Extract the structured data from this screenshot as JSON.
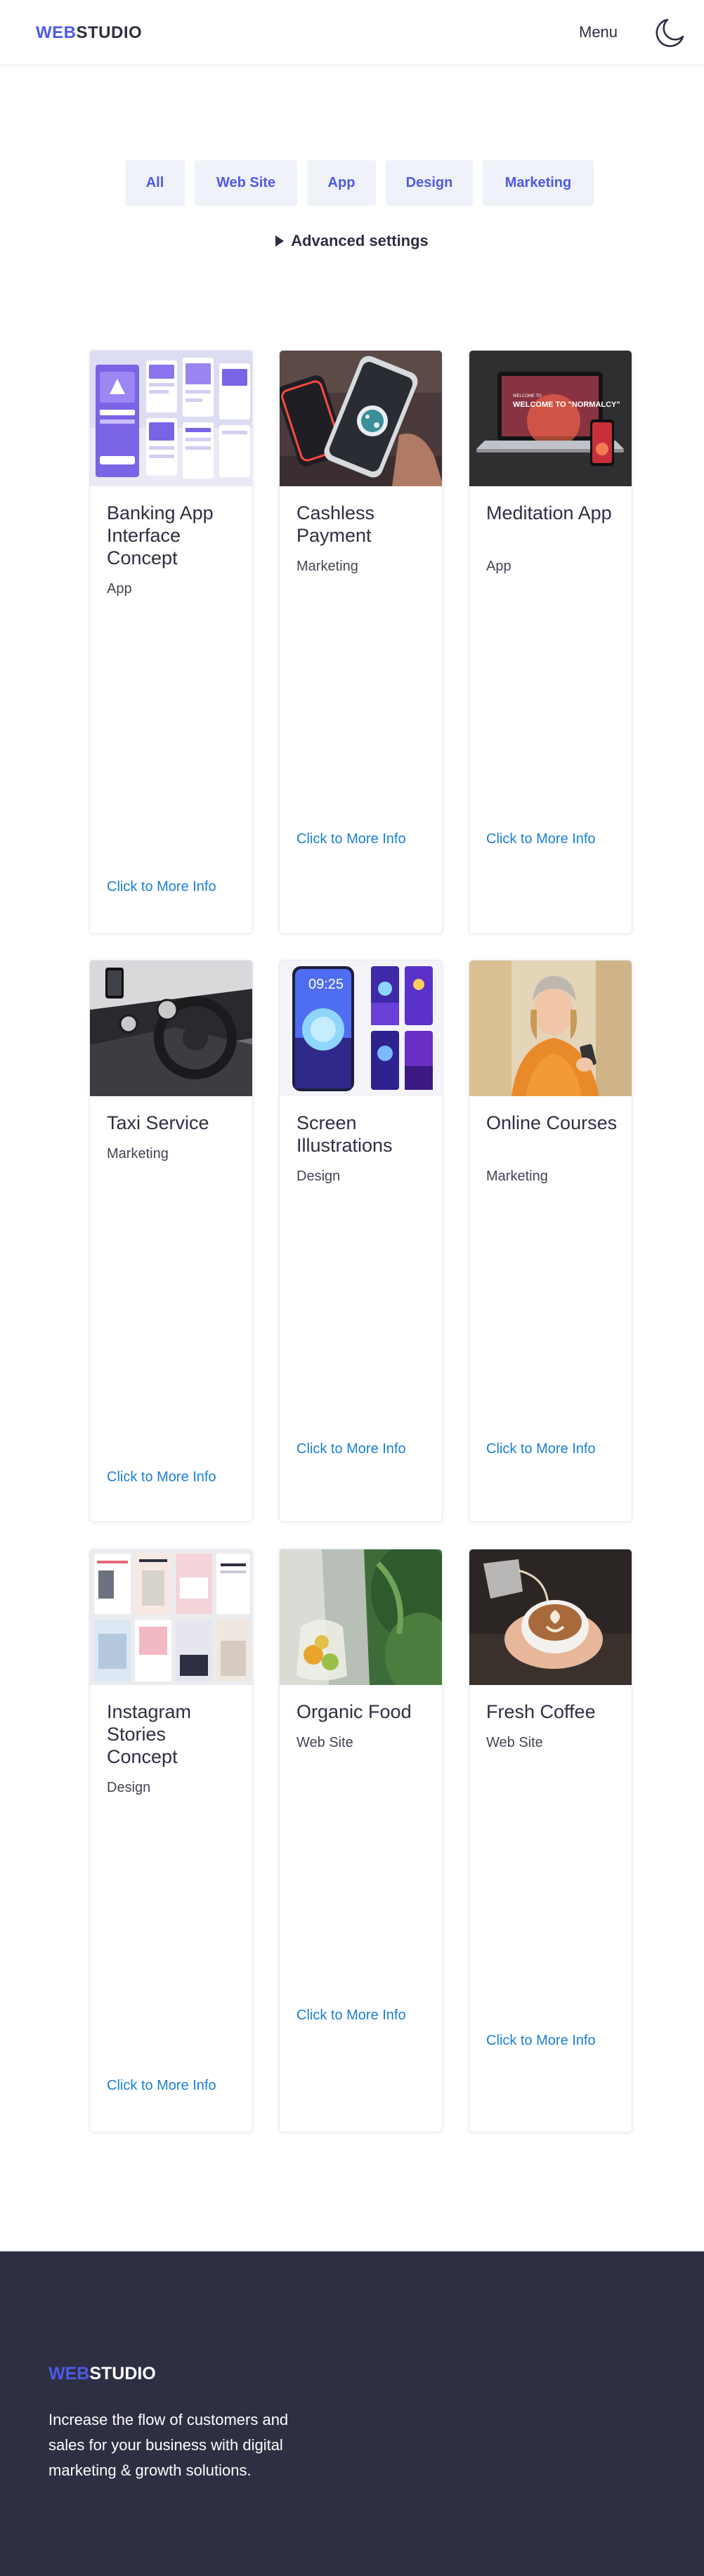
{
  "header": {
    "logo_accent": "WEB",
    "logo_rest": "STUDIO",
    "menu_label": "Menu",
    "theme_icon": "moon-icon"
  },
  "filters": {
    "items": [
      "All",
      "Web Site",
      "App",
      "Design",
      "Marketing"
    ],
    "advanced_label": "Advanced settings"
  },
  "projects": [
    {
      "title": "Banking App Interface Concept",
      "category": "App",
      "link": "Click to More Info"
    },
    {
      "title": "Cashless Payment",
      "category": "Marketing",
      "link": "Click to More Info"
    },
    {
      "title": "Meditation App",
      "category": "App",
      "link": "Click to More Info"
    },
    {
      "title": "Taxi Service",
      "category": "Marketing",
      "link": "Click to More Info"
    },
    {
      "title": "Screen Illustrations",
      "category": "Design",
      "link": "Click to More Info"
    },
    {
      "title": "Online Courses",
      "category": "Marketing",
      "link": "Click to More Info"
    },
    {
      "title": "Instagram Stories Concept",
      "category": "Design",
      "link": "Click to More Info"
    },
    {
      "title": "Organic Food",
      "category": "Web Site",
      "link": "Click to More Info"
    },
    {
      "title": "Fresh Coffee",
      "category": "Web Site",
      "link": "Click to More Info"
    }
  ],
  "thumb_texts": {
    "meditation_screen": "WELCOME TO \"NORMALCY\"",
    "screen_clock": "09:25"
  },
  "footer": {
    "logo_accent": "WEB",
    "logo_rest": "STUDIO",
    "tagline": "Increase the flow of customers and sales for your business with digital marketing & growth solutions."
  },
  "colors": {
    "accent": "#4d5ae5",
    "link": "#1a7fd6",
    "text_dark": "#2e2f42",
    "filter_bg": "#f0f2fa",
    "footer_bg": "#2e2f42"
  }
}
